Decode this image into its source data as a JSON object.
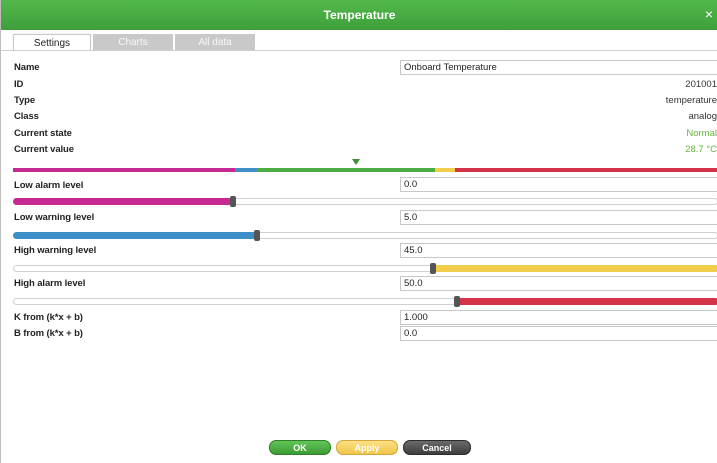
{
  "dialog": {
    "title": "Temperature",
    "close_symbol": "×"
  },
  "tabs": [
    {
      "label": "Settings",
      "active": true
    },
    {
      "label": "Charts",
      "active": false
    },
    {
      "label": "All data",
      "active": false
    }
  ],
  "info": {
    "name_label": "Name",
    "name_value": "Onboard Temperature",
    "id_label": "ID",
    "id_value": "201001",
    "type_label": "Type",
    "type_value": "temperature",
    "class_label": "Class",
    "class_value": "analog",
    "state_label": "Current state",
    "state_value": "Normal",
    "current_value_label": "Current value",
    "current_value": "28.7 °C"
  },
  "scale": {
    "colors": [
      "#c62a92",
      "#3e8fc8",
      "#4fac43",
      "#f2cc4b",
      "#d3344a"
    ],
    "current_fraction": 0.5
  },
  "levels": {
    "low_alarm_label": "Low alarm level",
    "low_alarm_value": "0.0",
    "low_alarm_fraction": 0.31,
    "low_warning_label": "Low warning level",
    "low_warning_value": "5.0",
    "low_warning_fraction": 0.345,
    "high_warning_label": "High warning level",
    "high_warning_value": "45.0",
    "high_warning_fraction": 0.595,
    "high_alarm_label": "High alarm level",
    "high_alarm_value": "50.0",
    "high_alarm_fraction": 0.628
  },
  "coefficients": {
    "k_label": "K from (k*x + b)",
    "k_value": "1.000",
    "b_label": "B from (k*x + b)",
    "b_value": "0.0"
  },
  "buttons": {
    "ok": "OK",
    "apply": "Apply",
    "cancel": "Cancel"
  }
}
